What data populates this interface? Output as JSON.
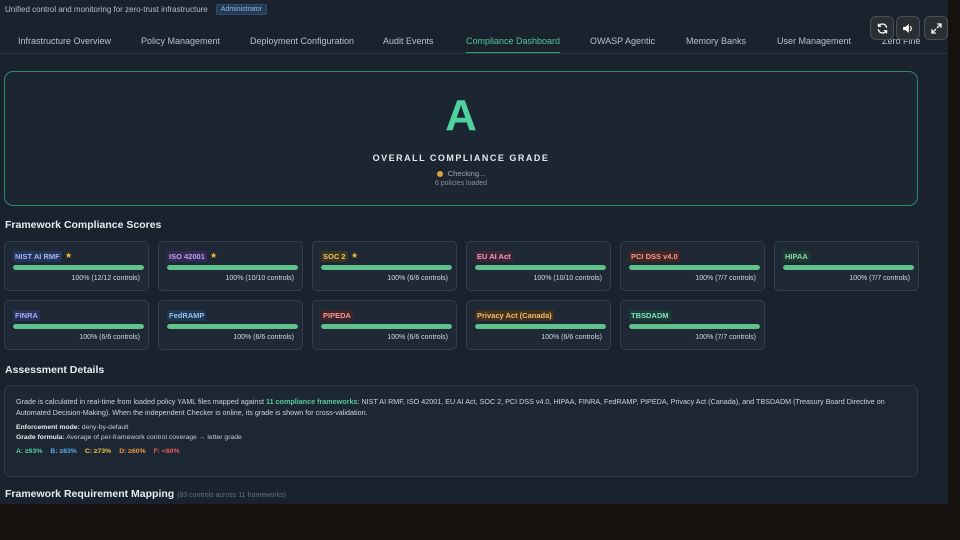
{
  "header": {
    "subtitle": "Unified control and monitoring for zero-trust infrastructure",
    "role_badge": "Administrator"
  },
  "window_controls": [
    {
      "name": "refresh-button",
      "icon": "refresh-icon"
    },
    {
      "name": "sound-button",
      "icon": "speaker-icon"
    },
    {
      "name": "fullscreen-button",
      "icon": "expand-icon"
    }
  ],
  "tabs": [
    {
      "label": "Infrastructure Overview",
      "active": false
    },
    {
      "label": "Policy Management",
      "active": false
    },
    {
      "label": "Deployment Configuration",
      "active": false
    },
    {
      "label": "Audit Events",
      "active": false
    },
    {
      "label": "Compliance Dashboard",
      "active": true
    },
    {
      "label": "OWASP Agentic",
      "active": false
    },
    {
      "label": "Memory Banks",
      "active": false
    },
    {
      "label": "User Management",
      "active": false
    },
    {
      "label": "Zero Fine",
      "active": false
    }
  ],
  "grade": {
    "letter": "A",
    "title": "OVERALL COMPLIANCE GRADE",
    "status": "Checking...",
    "policies": "6 policies loaded"
  },
  "scores_section": {
    "title": "Framework Compliance Scores"
  },
  "frameworks": [
    {
      "name": "NIST AI RMF",
      "star": true,
      "percent": 100,
      "score": "100% (12/12 controls)",
      "color": "#9fb6f2",
      "bg": "#27345a"
    },
    {
      "name": "ISO 42001",
      "star": true,
      "percent": 100,
      "score": "100% (10/10 controls)",
      "color": "#b9a3ef",
      "bg": "#322a54"
    },
    {
      "name": "SOC 2",
      "star": true,
      "percent": 100,
      "score": "100% (6/6 controls)",
      "color": "#e7c76a",
      "bg": "#3d3520"
    },
    {
      "name": "EU AI Act",
      "star": false,
      "percent": 100,
      "score": "100% (10/10 controls)",
      "color": "#e8a0c4",
      "bg": "#3f2536"
    },
    {
      "name": "PCI DSS v4.0",
      "star": false,
      "percent": 100,
      "score": "100% (7/7 controls)",
      "color": "#ef9b96",
      "bg": "#432624"
    },
    {
      "name": "HIPAA",
      "star": false,
      "percent": 100,
      "score": "100% (7/7 controls)",
      "color": "#8ed7b2",
      "bg": "#1f3a32"
    },
    {
      "name": "FINRA",
      "star": false,
      "percent": 100,
      "score": "100% (6/6 controls)",
      "color": "#a3b3f0",
      "bg": "#283158"
    },
    {
      "name": "FedRAMP",
      "star": false,
      "percent": 100,
      "score": "100% (6/6 controls)",
      "color": "#8fc4ef",
      "bg": "#203651"
    },
    {
      "name": "PIPEDA",
      "star": false,
      "percent": 100,
      "score": "100% (6/6 controls)",
      "color": "#ef9a9a",
      "bg": "#3f2426"
    },
    {
      "name": "Privacy Act (Canada)",
      "star": false,
      "percent": 100,
      "score": "100% (6/6 controls)",
      "color": "#efbd77",
      "bg": "#42311c"
    },
    {
      "name": "TBSDADM",
      "star": false,
      "percent": 100,
      "score": "100% (7/7 controls)",
      "color": "#86dcc7",
      "bg": "#1d3b36"
    }
  ],
  "assessment": {
    "title": "Assessment Details",
    "desc_pre": "Grade is calculated in real-time from loaded policy YAML files mapped against ",
    "desc_hl": "11 compliance frameworks",
    "desc_post": ": NIST AI RMF, ISO 42001, EU AI Act, SOC 2, PCI DSS v4.0, HIPAA, FINRA, FedRAMP, PIPEDA, Privacy Act (Canada), and TBSDADM (Treasury Board Directive on Automated Decision-Making). When the independent Checker is online, its grade is shown for cross-validation.",
    "enforcement_label": "Enforcement mode:",
    "enforcement_value": "deny-by-default",
    "formula_label": "Grade formula:",
    "formula_value": "Average of per-framework control coverage → letter grade",
    "scale": [
      {
        "label": "A: ≥93%",
        "color": "#4fd1a0"
      },
      {
        "label": "B: ≥83%",
        "color": "#5aa9f0"
      },
      {
        "label": "C: ≥73%",
        "color": "#e9c24a"
      },
      {
        "label": "D: ≥60%",
        "color": "#ef9540"
      },
      {
        "label": "F: <60%",
        "color": "#ef5b5b"
      }
    ]
  },
  "mapping": {
    "title": "Framework Requirement Mapping",
    "subtitle": "(83 controls across 11 frameworks)"
  }
}
